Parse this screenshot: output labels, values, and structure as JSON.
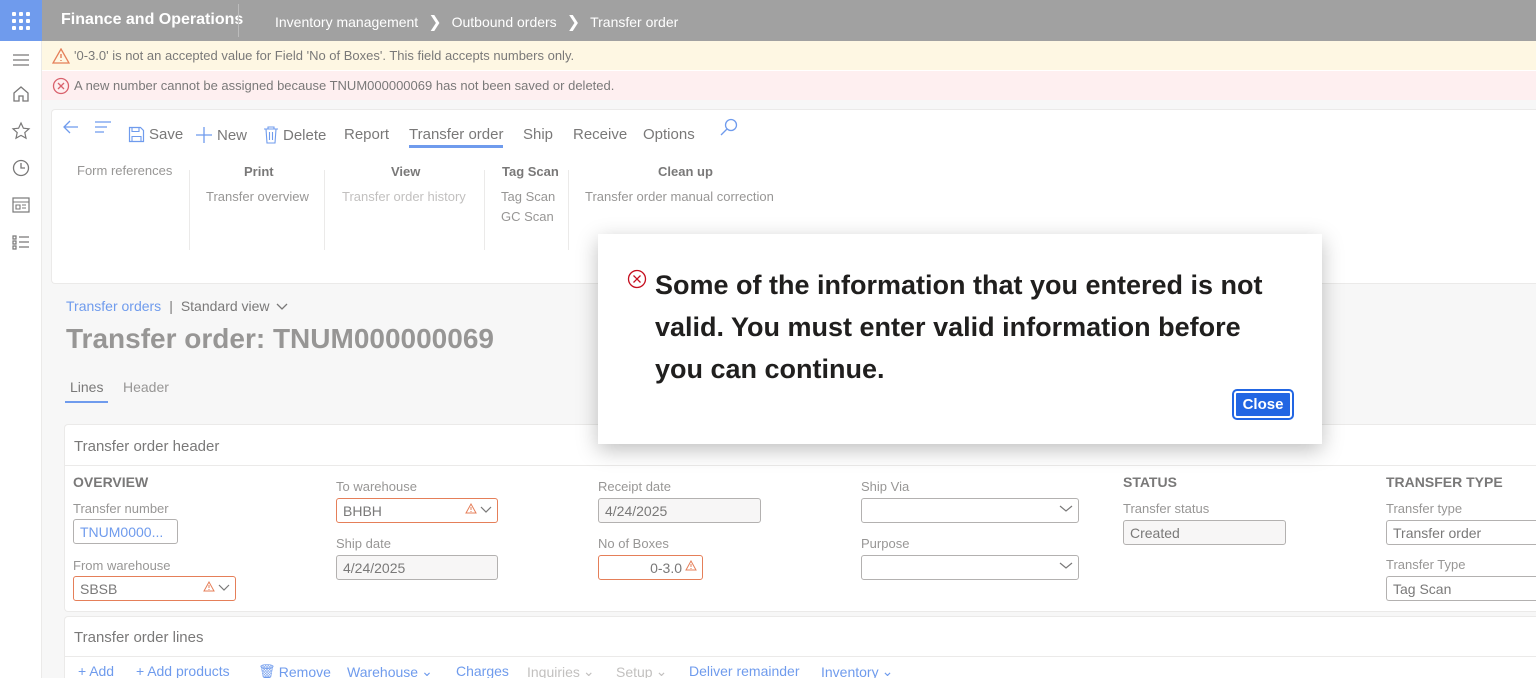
{
  "app": {
    "title": "Finance and Operations"
  },
  "breadcrumb": [
    "Inventory management",
    "Outbound orders",
    "Transfer order"
  ],
  "messages": {
    "warning": "'0-3.0' is not an accepted value for Field 'No of Boxes'. This field accepts numbers only.",
    "error": "A new number cannot be assigned because TNUM000000069 has not been saved or deleted."
  },
  "toolbar": {
    "save": "Save",
    "new": "New",
    "delete": "Delete",
    "report": "Report",
    "tabs": [
      "Transfer order",
      "Ship",
      "Receive",
      "Options"
    ]
  },
  "ribbon": {
    "form_references": "Form references",
    "print_title": "Print",
    "print_item": "Transfer overview",
    "view_title": "View",
    "view_item": "Transfer order history",
    "tagscan_title": "Tag Scan",
    "tagscan_items": [
      "Tag Scan",
      "GC Scan"
    ],
    "cleanup_title": "Clean up",
    "cleanup_item": "Transfer order manual correction"
  },
  "page": {
    "crumb_link": "Transfer orders",
    "view_label": "Standard view",
    "title": "Transfer order: TNUM000000069",
    "tabs": [
      "Lines",
      "Header"
    ]
  },
  "header_card": {
    "title": "Transfer order header",
    "overview": "OVERVIEW",
    "transfer_number_label": "Transfer number",
    "transfer_number": "TNUM0000...",
    "from_warehouse_label": "From warehouse",
    "from_warehouse": "SBSB",
    "to_warehouse_label": "To warehouse",
    "to_warehouse": "BHBH",
    "ship_date_label": "Ship date",
    "ship_date": "4/24/2025",
    "receipt_date_label": "Receipt date",
    "receipt_date": "4/24/2025",
    "boxes_label": "No of Boxes",
    "boxes": "0-3.0",
    "ship_via_label": "Ship Via",
    "ship_via": "",
    "purpose_label": "Purpose",
    "purpose": "",
    "status_section": "STATUS",
    "status_label": "Transfer status",
    "status": "Created",
    "type_section": "TRANSFER TYPE",
    "type_label": "Transfer type",
    "type": "Transfer order",
    "type2_label": "Transfer Type",
    "type2": "Tag Scan"
  },
  "lines_card": {
    "title": "Transfer order lines",
    "actions": [
      "Add",
      "Add products",
      "Remove",
      "Warehouse",
      "Charges",
      "Inquiries",
      "Setup",
      "Deliver remainder",
      "Inventory"
    ]
  },
  "dialog": {
    "message": "Some of the information that you entered is not valid. You must enter valid information before you can continue.",
    "close": "Close"
  },
  "colors": {
    "accent": "#2266e3",
    "warning_bg": "#fdf3d4",
    "error_bg": "#fde7e9",
    "error_icon": "#c50f1f",
    "warn_icon": "#d83b01"
  }
}
